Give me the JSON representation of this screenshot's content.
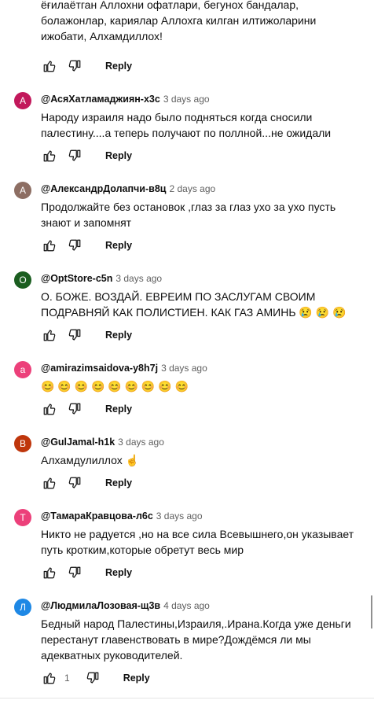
{
  "partial_comment": {
    "lines": [
      "ёғилаётган Аллохни офатлари, бегунох бандалар,",
      "болажонлар, кариялар Аллохга килган илтижоларини",
      "ижобати, Алхамдиллох!"
    ],
    "reply_label": "Reply"
  },
  "comments": [
    {
      "initial": "А",
      "avatar_color": "#c2185b",
      "author": "@АсяХатламаджиян-х3с",
      "time": "3 days ago",
      "lines": [
        "Народу израиля надо было подняться когда сносили",
        "палестину....а теперь получают по поллной...не ожидали"
      ],
      "reply_label": "Reply"
    },
    {
      "initial": "А",
      "avatar_color": "#8d6e63",
      "author": "@АлександрДолапчи-в8ц",
      "time": "2 days ago",
      "lines": [
        "Продолжайте без остановок ,глаз за глаз ухо за ухо пусть",
        "знают и запомнят"
      ],
      "reply_label": "Reply"
    },
    {
      "initial": "O",
      "avatar_color": "#1b5e20",
      "author": "@OptStore-c5n",
      "time": "3 days ago",
      "lines": [
        "О. БОЖЕ. ВОЗДАЙ. ЕВРЕИМ ПО  ЗАСЛУГАМ СВОИМ",
        "ПОДРАВНЯЙ КАК ПОЛИСТИЕН. КАК ГАЗ  АМИНЬ 😢 😢 😢"
      ],
      "reply_label": "Reply"
    },
    {
      "initial": "a",
      "avatar_color": "#ec407a",
      "author": "@amirazimsaidova-y8h7j",
      "time": "3 days ago",
      "lines": [
        "😊 😊 😊 😊 😊 😊 😊 😊 😊"
      ],
      "reply_label": "Reply"
    },
    {
      "initial": "B",
      "avatar_color": "#bf360c",
      "author": "@GulJamal-h1k",
      "time": "3 days ago",
      "lines": [
        "Алхамдулиллох ☝"
      ],
      "reply_label": "Reply"
    },
    {
      "initial": "Т",
      "avatar_color": "#ec407a",
      "author": "@ТамараКравцова-л6с",
      "time": "3 days ago",
      "lines": [
        "Никто не радуется ,но на все сила Всевышнего,он указывает",
        "путь кротким,которые обретут весь мир"
      ],
      "reply_label": "Reply"
    },
    {
      "initial": "Л",
      "avatar_color": "#1e88e5",
      "author": "@ЛюдмилаЛозовая-щ3в",
      "time": "4 days ago",
      "lines": [
        "Бедный народ Палестины,Израиля,.Ирана.Когда уже деньги",
        "перестанут главенствовать в мире?Дождёмся ли мы",
        "адекватных руководителей."
      ],
      "like_count": "1",
      "reply_label": "Reply"
    }
  ],
  "icons": {
    "like": "thumb-up-icon",
    "dislike": "thumb-down-icon"
  }
}
